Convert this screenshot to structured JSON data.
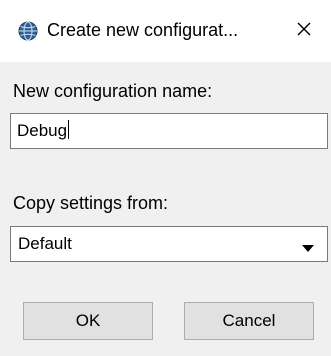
{
  "window": {
    "title": "Create new configurat...",
    "app_icon": "globe-icon",
    "close_glyph": "✕"
  },
  "form": {
    "name_label": "New configuration name:",
    "name_value": "Debug",
    "copy_label": "Copy settings from:",
    "copy_selected": "Default"
  },
  "buttons": {
    "ok": "OK",
    "cancel": "Cancel"
  }
}
